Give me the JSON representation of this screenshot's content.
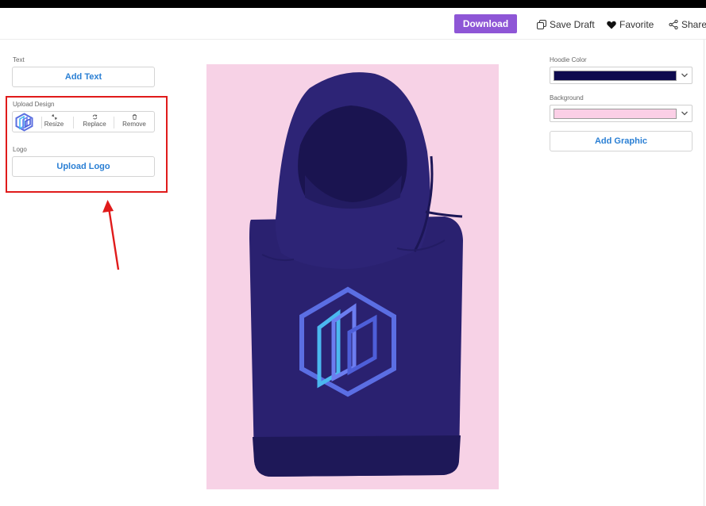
{
  "header": {
    "download_label": "Download",
    "save_draft_label": "Save Draft",
    "favorite_label": "Favorite",
    "share_label": "Share"
  },
  "left_panel": {
    "text_section_label": "Text",
    "add_text_label": "Add Text",
    "upload_design_label": "Upload Design",
    "resize_label": "Resize",
    "replace_label": "Replace",
    "remove_label": "Remove",
    "logo_section_label": "Logo",
    "upload_logo_label": "Upload Logo"
  },
  "right_panel": {
    "hoodie_color_label": "Hoodie Color",
    "hoodie_color_value": "#0e0a4e",
    "background_label": "Background",
    "background_value": "#fbcfe6",
    "add_graphic_label": "Add Graphic"
  },
  "colors": {
    "accent": "#8e56d6",
    "link": "#2a7fd4",
    "highlight": "#e01b1b",
    "preview_bg": "#f7d2e6",
    "hoodie": "#2a2170"
  }
}
